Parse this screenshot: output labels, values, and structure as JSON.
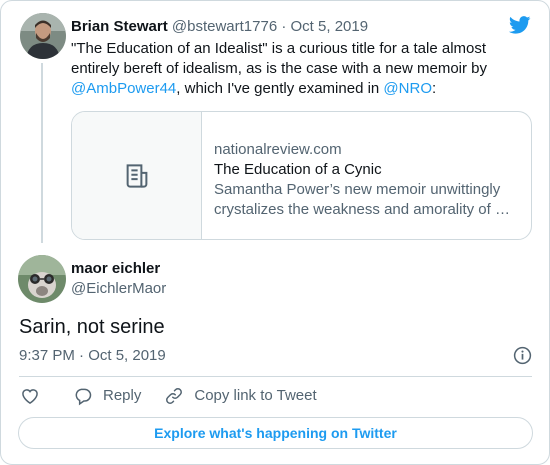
{
  "parent_tweet": {
    "author_name": "Brian Stewart",
    "author_handle": "@bstewart1776",
    "separator": " · ",
    "date": "Oct 5, 2019",
    "text_part1": "\"The Education of an Idealist\" is a curious title for a tale almost entirely bereft of idealism, as is the case with a new memoir by ",
    "mention1": "@AmbPower44",
    "text_part2": ", which I've gently examined in ",
    "mention2": "@NRO",
    "text_part3": ":"
  },
  "link_card": {
    "domain": "nationalreview.com",
    "title": "The Education of a Cynic",
    "description": "Samantha Power’s new memoir unwittingly crystalizes the weakness and amorality of …",
    "thumbnail_icon": "article-icon"
  },
  "reply_tweet": {
    "author_name": "maor eichler",
    "author_handle": "@EichlerMaor",
    "text": "Sarin, not serine",
    "timestamp": "9:37 PM · Oct 5, 2019"
  },
  "actions": {
    "like_icon": "heart-icon",
    "reply_label": "Reply",
    "reply_icon": "speech-bubble-icon",
    "copy_label": "Copy link to Tweet",
    "copy_icon": "link-icon"
  },
  "explore_button": "Explore what's happening on Twitter",
  "colors": {
    "accent": "#1d9bf0",
    "text": "#0f1419",
    "muted": "#536471",
    "border": "#cfd9de"
  }
}
